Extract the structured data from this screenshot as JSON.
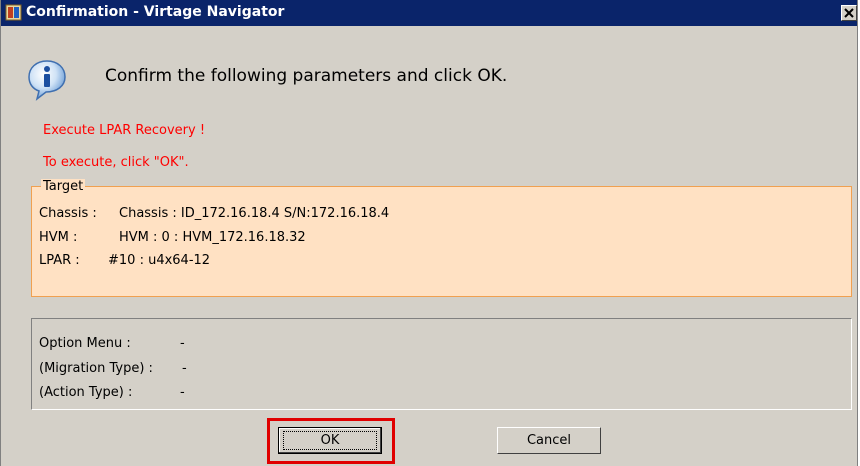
{
  "window": {
    "title": "Confirmation - Virtage Navigator",
    "title_icon": "app-icon",
    "close_label": "close",
    "colors": {
      "titlebar": "#0a246a",
      "dialog_bg": "#d4d0c8",
      "warning_text": "#ff0000",
      "target_bg": "#ffe1c3",
      "target_border": "#f0a050",
      "highlight": "#e00000"
    }
  },
  "header": {
    "icon": "info-icon",
    "message": "Confirm the following parameters and click OK."
  },
  "warnings": {
    "line1": "Execute LPAR Recovery !",
    "line2": "To execute, click \"OK\"."
  },
  "target": {
    "legend": "Target",
    "rows": [
      {
        "label": "Chassis :",
        "value": "Chassis : ID_172.16.18.4 S/N:172.16.18.4"
      },
      {
        "label": "HVM :",
        "value": "HVM : 0 : HVM_172.16.18.32"
      },
      {
        "label": "LPAR :",
        "value": "#10 : u4x64-12"
      }
    ]
  },
  "options": {
    "rows": [
      {
        "label": "Option Menu :",
        "value": "-"
      },
      {
        "label": "(Migration Type) :",
        "value": "-"
      },
      {
        "label": "(Action Type) :",
        "value": "-"
      }
    ]
  },
  "buttons": {
    "ok": "OK",
    "cancel": "Cancel"
  }
}
